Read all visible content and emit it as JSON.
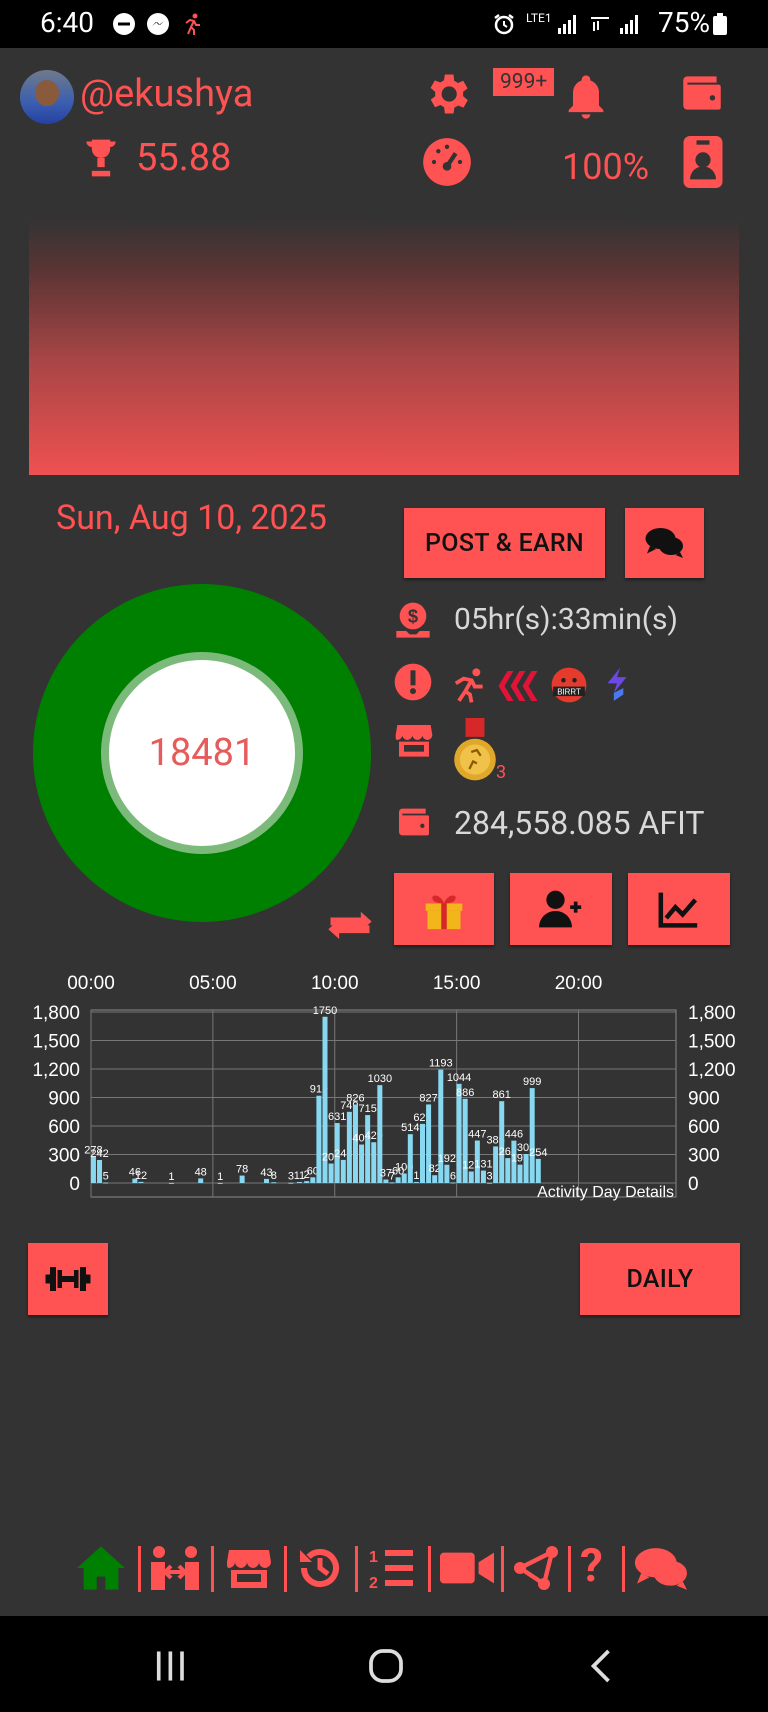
{
  "status_bar": {
    "time": "6:40",
    "battery": "75%",
    "network": "LTE1"
  },
  "header": {
    "username": "@ekushya",
    "trophy_score": "55.88",
    "notification_count": "999+",
    "percent": "100%"
  },
  "main": {
    "date": "Sun, Aug 10, 2025",
    "post_earn_label": "POST & EARN",
    "steps": "18481",
    "timer": "05hr(s):33min(s)",
    "medal_count": "3",
    "balance": "284,558.085 AFIT",
    "daily_label": "DAILY"
  },
  "icons": {
    "settings": "gear-icon",
    "bell": "bell-icon",
    "wallet": "wallet-icon",
    "gauge": "gauge-icon",
    "profile": "id-badge-icon"
  },
  "colors": {
    "accent": "#ff5252",
    "background": "#333333",
    "donut": "#008000",
    "bars": "#87d8f0"
  },
  "chart_data": {
    "type": "bar",
    "title": "Activity Day Details",
    "x_ticks": [
      "00:00",
      "05:00",
      "10:00",
      "15:00",
      "20:00"
    ],
    "y_ticks": [
      "0",
      "300",
      "600",
      "900",
      "1,200",
      "1,500",
      "1,800"
    ],
    "ylim": [
      0,
      1800
    ],
    "x_range_hours": [
      0,
      24
    ],
    "grid": true,
    "values": [
      {
        "t": 0.1,
        "v": 278,
        "label": "278"
      },
      {
        "t": 0.35,
        "v": 242,
        "label": "242"
      },
      {
        "t": 0.6,
        "v": 5,
        "label": "5"
      },
      {
        "t": 1.8,
        "v": 46,
        "label": "46"
      },
      {
        "t": 2.05,
        "v": 12,
        "label": "12"
      },
      {
        "t": 3.3,
        "v": 1,
        "label": "1"
      },
      {
        "t": 4.5,
        "v": 48,
        "label": "48"
      },
      {
        "t": 5.3,
        "v": 1,
        "label": "1"
      },
      {
        "t": 6.2,
        "v": 78,
        "label": "78"
      },
      {
        "t": 7.2,
        "v": 43,
        "label": "43"
      },
      {
        "t": 7.5,
        "v": 8,
        "label": "8"
      },
      {
        "t": 8.2,
        "v": 3,
        "label": "3"
      },
      {
        "t": 8.55,
        "v": 11,
        "label": "11"
      },
      {
        "t": 8.85,
        "v": 20,
        "label": "2"
      },
      {
        "t": 9.1,
        "v": 60,
        "label": "60"
      },
      {
        "t": 9.35,
        "v": 919,
        "label": "919"
      },
      {
        "t": 9.6,
        "v": 1750,
        "label": "1750"
      },
      {
        "t": 9.85,
        "v": 205,
        "label": "205"
      },
      {
        "t": 10.1,
        "v": 631,
        "label": "631"
      },
      {
        "t": 10.35,
        "v": 243,
        "label": "243"
      },
      {
        "t": 10.6,
        "v": 749,
        "label": "749"
      },
      {
        "t": 10.85,
        "v": 826,
        "label": "826"
      },
      {
        "t": 11.1,
        "v": 405,
        "label": "405"
      },
      {
        "t": 11.35,
        "v": 715,
        "label": "715"
      },
      {
        "t": 11.6,
        "v": 429,
        "label": "429"
      },
      {
        "t": 11.85,
        "v": 1030,
        "label": "1030"
      },
      {
        "t": 12.1,
        "v": 37,
        "label": "37"
      },
      {
        "t": 12.35,
        "v": 7,
        "label": "7"
      },
      {
        "t": 12.6,
        "v": 60,
        "label": "60"
      },
      {
        "t": 12.85,
        "v": 100,
        "label": "100"
      },
      {
        "t": 13.1,
        "v": 514,
        "label": "514"
      },
      {
        "t": 13.35,
        "v": 11,
        "label": "1"
      },
      {
        "t": 13.6,
        "v": 622,
        "label": "622"
      },
      {
        "t": 13.85,
        "v": 827,
        "label": "827"
      },
      {
        "t": 14.1,
        "v": 82,
        "label": "82"
      },
      {
        "t": 14.35,
        "v": 1193,
        "label": "1193"
      },
      {
        "t": 14.6,
        "v": 192,
        "label": "192"
      },
      {
        "t": 14.85,
        "v": 6,
        "label": "6"
      },
      {
        "t": 15.1,
        "v": 1044,
        "label": "1044"
      },
      {
        "t": 15.35,
        "v": 886,
        "label": "886"
      },
      {
        "t": 15.6,
        "v": 121,
        "label": "121"
      },
      {
        "t": 15.85,
        "v": 447,
        "label": "447"
      },
      {
        "t": 16.1,
        "v": 131,
        "label": "131"
      },
      {
        "t": 16.35,
        "v": 3,
        "label": "3"
      },
      {
        "t": 16.6,
        "v": 385,
        "label": "385"
      },
      {
        "t": 16.85,
        "v": 861,
        "label": "861"
      },
      {
        "t": 17.1,
        "v": 262,
        "label": "262"
      },
      {
        "t": 17.35,
        "v": 446,
        "label": "446"
      },
      {
        "t": 17.6,
        "v": 193,
        "label": "193"
      },
      {
        "t": 17.85,
        "v": 305,
        "label": "305"
      },
      {
        "t": 18.1,
        "v": 999,
        "label": "999"
      },
      {
        "t": 18.35,
        "v": 254,
        "label": "254"
      }
    ]
  },
  "bottom_nav": [
    "home-icon",
    "coach-icon",
    "store-icon",
    "history-icon",
    "list-icon",
    "video-icon",
    "share-icon",
    "help-icon",
    "chat-icon"
  ]
}
